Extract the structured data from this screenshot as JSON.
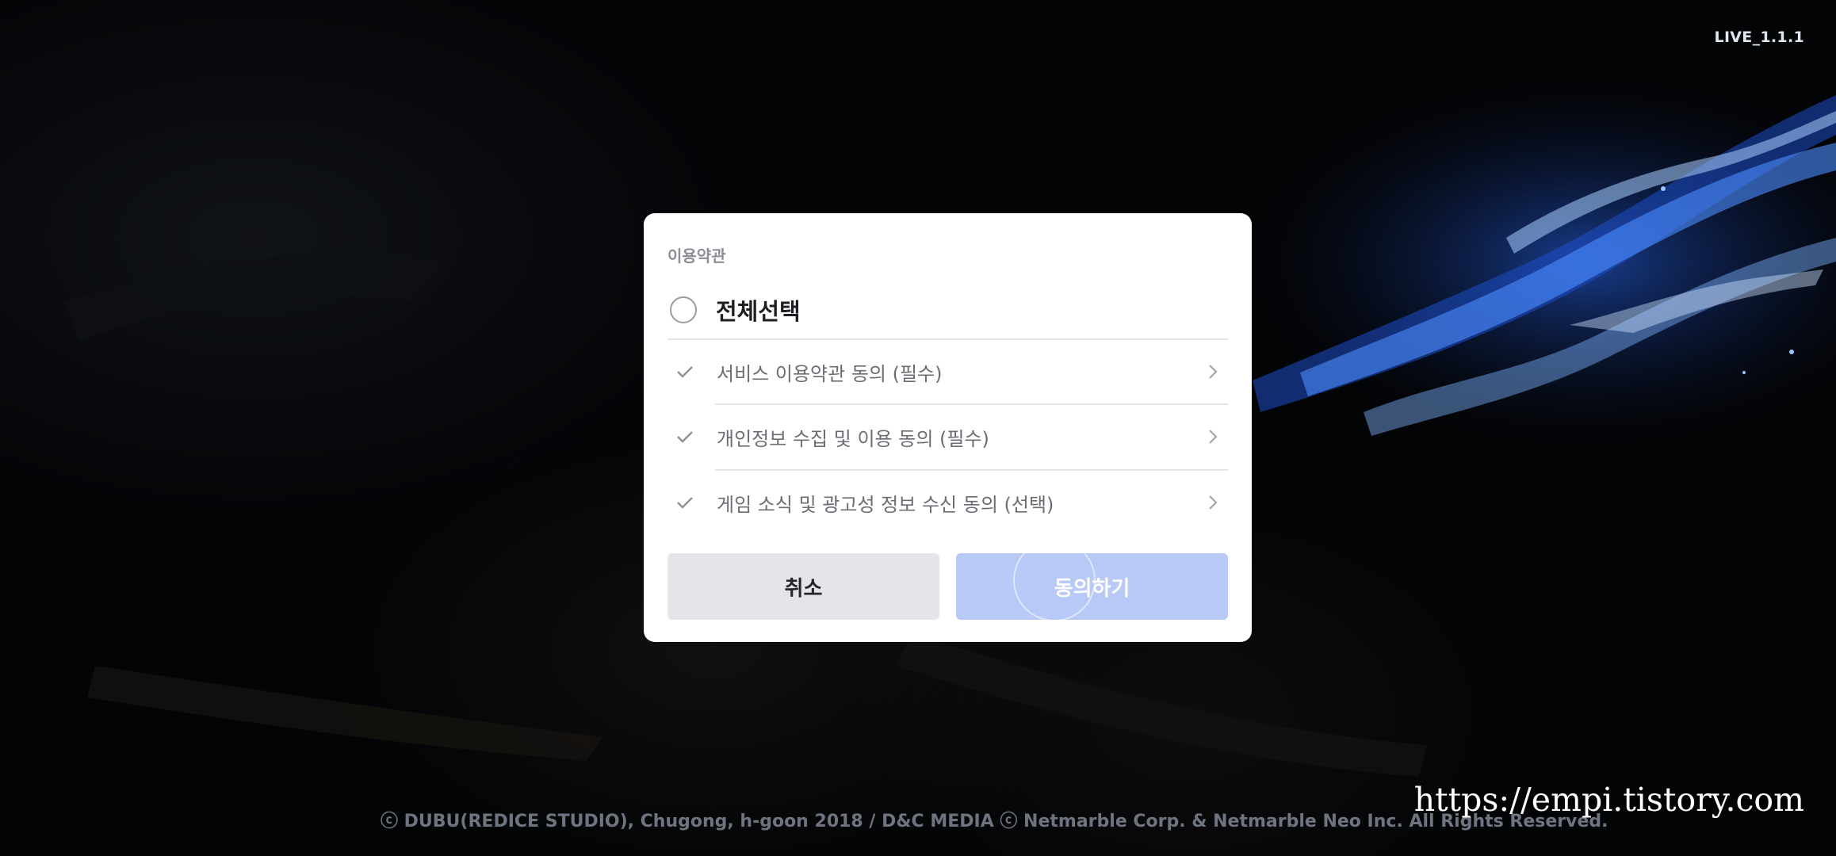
{
  "version": "LIVE_1.1.1",
  "dialog": {
    "title": "이용약관",
    "select_all_label": "전체선택",
    "terms": [
      {
        "label": "서비스 이용약관 동의 (필수)"
      },
      {
        "label": "개인정보 수집 및 이용 동의 (필수)"
      },
      {
        "label": "게임 소식 및 광고성 정보 수신 동의 (선택)"
      }
    ],
    "cancel_label": "취소",
    "agree_label": "동의하기"
  },
  "footer": {
    "copyright": "ⓒ DUBU(REDICE STUDIO), Chugong, h-goon 2018 / D&C MEDIA ⓒ Netmarble Corp. & Netmarble Neo Inc. All Rights Reserved."
  },
  "watermark": "https://empi.tistory.com",
  "colors": {
    "agree_button": "#b8c9f7",
    "cancel_button": "#e4e5e9",
    "background": "#030406",
    "flame_accent": "#3f8fff"
  },
  "icons": {
    "select_all": "radio-circle-icon",
    "term_check": "check-icon",
    "term_open": "chevron-right-icon"
  }
}
